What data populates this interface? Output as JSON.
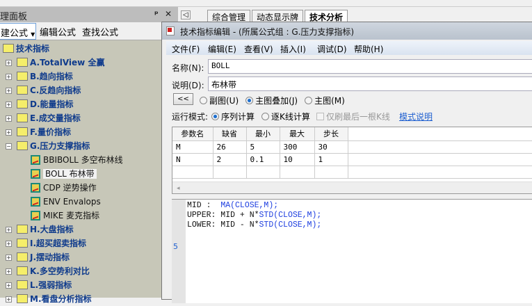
{
  "panel": {
    "title": "理面板",
    "pin": "ᵖ",
    "close": "✕",
    "toolbar": {
      "new": "建公式",
      "edit": "编辑公式",
      "find": "查找公式"
    }
  },
  "tree": {
    "root": "技术指标",
    "groups": [
      {
        "label": "A.TotalView 全赢"
      },
      {
        "label": "B.趋向指标"
      },
      {
        "label": "C.反趋向指标"
      },
      {
        "label": "D.能量指标"
      },
      {
        "label": "E.成交量指标"
      },
      {
        "label": "F.量价指标"
      },
      {
        "label": "G.压力支撑指标",
        "expanded": true,
        "children": [
          "BBIBOLL 多空布林线",
          "BOLL 布林带",
          "CDP 逆势操作",
          "ENV Envalops",
          "MIKE 麦克指标"
        ]
      },
      {
        "label": "H.大盘指标"
      },
      {
        "label": "I.超买超卖指标"
      },
      {
        "label": "J.摆动指标"
      },
      {
        "label": "K.多空势利对比"
      },
      {
        "label": "L.强弱指标"
      },
      {
        "label": "M.看盘分析指标"
      }
    ],
    "selected": "BOLL 布林带"
  },
  "tabs": {
    "scroll": "◁",
    "items": [
      "综合管理",
      "动态显示牌",
      "技术分析"
    ],
    "active": 2
  },
  "dialog": {
    "title": "技术指标编辑 - (所属公式组 : G.压力支撑指标)",
    "menu": [
      "文件(F)",
      "编辑(E)",
      "查看(V)",
      "插入(I)",
      "调试(D)",
      "帮助(H)"
    ],
    "name_label": "名称(N):",
    "name_value": "BOLL",
    "desc_label": "说明(D):",
    "desc_value": "布林带",
    "collapse_btn": "<<",
    "chart_types": [
      "副图(U)",
      "主图叠加(J)",
      "主图(M)"
    ],
    "chart_type_selected": 1,
    "run_mode_label": "运行模式:",
    "run_modes": [
      "序列计算",
      "逐K线计算"
    ],
    "run_mode_selected": 0,
    "last_bar_only": "仅刷最后一根K线",
    "last_bar_checked": false,
    "mode_help": "模式说明",
    "params": {
      "headers": [
        "参数名",
        "缺省",
        "最小",
        "最大",
        "步长"
      ],
      "rows": [
        [
          "M",
          "26",
          "5",
          "300",
          "30"
        ],
        [
          "N",
          "2",
          "0.1",
          "10",
          "1"
        ]
      ]
    },
    "grid_scroll": "◂",
    "code": [
      [
        "MID :  ",
        "MA(CLOSE,M);"
      ],
      [
        "UPPER: MID + N*",
        "STD(CLOSE,M);"
      ],
      [
        "LOWER: MID - N*",
        "STD(CLOSE,M);"
      ]
    ],
    "gutter_mark": "5"
  }
}
